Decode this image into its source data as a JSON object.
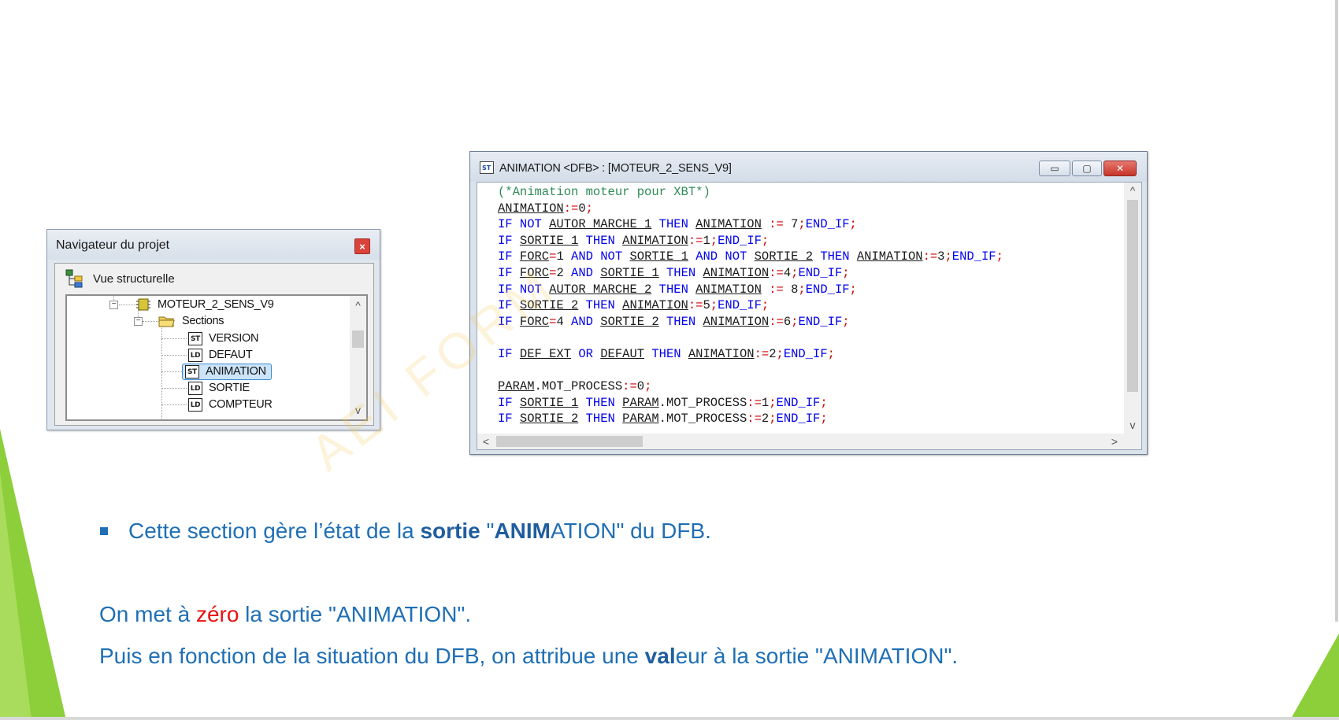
{
  "colors": {
    "slide_text": "#1f6fb5",
    "emphasis_red": "#e81010",
    "accent_green": "#8ccf3a",
    "code_keyword": "#0000ee",
    "code_operator": "#cc0000",
    "code_comment": "#2e8b57"
  },
  "navigator": {
    "title": "Navigateur du projet",
    "close_label": "×",
    "view_label": "Vue structurelle",
    "tree": {
      "root": "MOTEUR_2_SENS_V9",
      "sections_label": "Sections",
      "items": [
        {
          "type": "ST",
          "label": "VERSION"
        },
        {
          "type": "LD",
          "label": "DEFAUT"
        },
        {
          "type": "ST",
          "label": "ANIMATION",
          "selected": true
        },
        {
          "type": "LD",
          "label": "SORTIE"
        },
        {
          "type": "LD",
          "label": "COMPTEUR"
        }
      ]
    },
    "scroll_up": "^",
    "scroll_down": "v"
  },
  "code_window": {
    "title": "ANIMATION <DFB> : [MOTEUR_2_SENS_V9]",
    "icon": "st-section-icon",
    "min_label": "▭",
    "max_label": "▢",
    "close_label": "✕",
    "scroll_up": "^",
    "scroll_down": "v",
    "scroll_left": "<",
    "scroll_right": ">",
    "lines": [
      [
        {
          "t": "cmt",
          "s": "(*Animation moteur pour XBT*)"
        }
      ],
      [
        {
          "t": "var",
          "s": "ANIMATION"
        },
        {
          "t": "op",
          "s": ":="
        },
        {
          "t": "num",
          "s": "0"
        },
        {
          "t": "op",
          "s": ";"
        }
      ],
      [
        {
          "t": "kw",
          "s": "IF NOT "
        },
        {
          "t": "var",
          "s": "AUTOR MARCHE 1"
        },
        {
          "t": "kw",
          "s": " THEN "
        },
        {
          "t": "var",
          "s": "ANIMATION"
        },
        {
          "t": "op",
          "s": " := "
        },
        {
          "t": "num",
          "s": "7"
        },
        {
          "t": "op",
          "s": ";"
        },
        {
          "t": "kw",
          "s": "END_IF"
        },
        {
          "t": "op",
          "s": ";"
        }
      ],
      [
        {
          "t": "kw",
          "s": "IF "
        },
        {
          "t": "var",
          "s": "SORTIE 1"
        },
        {
          "t": "kw",
          "s": " THEN "
        },
        {
          "t": "var",
          "s": "ANIMATION"
        },
        {
          "t": "op",
          "s": ":="
        },
        {
          "t": "num",
          "s": "1"
        },
        {
          "t": "op",
          "s": ";"
        },
        {
          "t": "kw",
          "s": "END_IF"
        },
        {
          "t": "op",
          "s": ";"
        }
      ],
      [
        {
          "t": "kw",
          "s": "IF "
        },
        {
          "t": "var",
          "s": "FORC"
        },
        {
          "t": "op",
          "s": "="
        },
        {
          "t": "num",
          "s": "1"
        },
        {
          "t": "kw",
          "s": " AND NOT "
        },
        {
          "t": "var",
          "s": "SORTIE 1"
        },
        {
          "t": "kw",
          "s": " AND NOT "
        },
        {
          "t": "var",
          "s": "SORTIE 2"
        },
        {
          "t": "kw",
          "s": " THEN "
        },
        {
          "t": "var",
          "s": "ANIMATION"
        },
        {
          "t": "op",
          "s": ":="
        },
        {
          "t": "num",
          "s": "3"
        },
        {
          "t": "op",
          "s": ";"
        },
        {
          "t": "kw",
          "s": "END_IF"
        },
        {
          "t": "op",
          "s": ";"
        }
      ],
      [
        {
          "t": "kw",
          "s": "IF "
        },
        {
          "t": "var",
          "s": "FORC"
        },
        {
          "t": "op",
          "s": "="
        },
        {
          "t": "num",
          "s": "2"
        },
        {
          "t": "kw",
          "s": " AND "
        },
        {
          "t": "var",
          "s": "SORTIE 1"
        },
        {
          "t": "kw",
          "s": " THEN "
        },
        {
          "t": "var",
          "s": "ANIMATION"
        },
        {
          "t": "op",
          "s": ":="
        },
        {
          "t": "num",
          "s": "4"
        },
        {
          "t": "op",
          "s": ";"
        },
        {
          "t": "kw",
          "s": "END_IF"
        },
        {
          "t": "op",
          "s": ";"
        }
      ],
      [
        {
          "t": "kw",
          "s": "IF NOT "
        },
        {
          "t": "var",
          "s": "AUTOR MARCHE 2"
        },
        {
          "t": "kw",
          "s": " THEN "
        },
        {
          "t": "var",
          "s": "ANIMATION"
        },
        {
          "t": "op",
          "s": " := "
        },
        {
          "t": "num",
          "s": "8"
        },
        {
          "t": "op",
          "s": ";"
        },
        {
          "t": "kw",
          "s": "END_IF"
        },
        {
          "t": "op",
          "s": ";"
        }
      ],
      [
        {
          "t": "kw",
          "s": "IF "
        },
        {
          "t": "var",
          "s": "SORTIE 2"
        },
        {
          "t": "kw",
          "s": " THEN "
        },
        {
          "t": "var",
          "s": "ANIMATION"
        },
        {
          "t": "op",
          "s": ":="
        },
        {
          "t": "num",
          "s": "5"
        },
        {
          "t": "op",
          "s": ";"
        },
        {
          "t": "kw",
          "s": "END_IF"
        },
        {
          "t": "op",
          "s": ";"
        }
      ],
      [
        {
          "t": "kw",
          "s": "IF "
        },
        {
          "t": "var",
          "s": "FORC"
        },
        {
          "t": "op",
          "s": "="
        },
        {
          "t": "num",
          "s": "4"
        },
        {
          "t": "kw",
          "s": " AND "
        },
        {
          "t": "var",
          "s": "SORTIE 2"
        },
        {
          "t": "kw",
          "s": " THEN "
        },
        {
          "t": "var",
          "s": "ANIMATION"
        },
        {
          "t": "op",
          "s": ":="
        },
        {
          "t": "num",
          "s": "6"
        },
        {
          "t": "op",
          "s": ";"
        },
        {
          "t": "kw",
          "s": "END_IF"
        },
        {
          "t": "op",
          "s": ";"
        }
      ],
      [],
      [
        {
          "t": "kw",
          "s": "IF "
        },
        {
          "t": "var",
          "s": "DEF EXT"
        },
        {
          "t": "kw",
          "s": " OR "
        },
        {
          "t": "var",
          "s": "DEFAUT"
        },
        {
          "t": "kw",
          "s": " THEN "
        },
        {
          "t": "var",
          "s": "ANIMATION"
        },
        {
          "t": "op",
          "s": ":="
        },
        {
          "t": "num",
          "s": "2"
        },
        {
          "t": "op",
          "s": ";"
        },
        {
          "t": "kw",
          "s": "END_IF"
        },
        {
          "t": "op",
          "s": ";"
        }
      ],
      [],
      [
        {
          "t": "var",
          "s": "PARAM"
        },
        {
          "t": "pl",
          "s": ".MOT_PROCESS"
        },
        {
          "t": "op",
          "s": ":="
        },
        {
          "t": "num",
          "s": "0"
        },
        {
          "t": "op",
          "s": ";"
        }
      ],
      [
        {
          "t": "kw",
          "s": "IF "
        },
        {
          "t": "var",
          "s": "SORTIE 1"
        },
        {
          "t": "kw",
          "s": " THEN "
        },
        {
          "t": "var",
          "s": "PARAM"
        },
        {
          "t": "pl",
          "s": ".MOT_PROCESS"
        },
        {
          "t": "op",
          "s": ":="
        },
        {
          "t": "num",
          "s": "1"
        },
        {
          "t": "op",
          "s": ";"
        },
        {
          "t": "kw",
          "s": "END_IF"
        },
        {
          "t": "op",
          "s": ";"
        }
      ],
      [
        {
          "t": "kw",
          "s": "IF "
        },
        {
          "t": "var",
          "s": "SORTIE 2"
        },
        {
          "t": "kw",
          "s": " THEN "
        },
        {
          "t": "var",
          "s": "PARAM"
        },
        {
          "t": "pl",
          "s": ".MOT_PROCESS"
        },
        {
          "t": "op",
          "s": ":="
        },
        {
          "t": "num",
          "s": "2"
        },
        {
          "t": "op",
          "s": ";"
        },
        {
          "t": "kw",
          "s": "END_IF"
        },
        {
          "t": "op",
          "s": ";"
        }
      ]
    ]
  },
  "watermark": "AEI   FORM",
  "text": {
    "bullet": {
      "pre": "Cette section gère l’état de la ",
      "sortie": "sortie",
      "q1": " \"",
      "anim_bold": "ANIM",
      "anim_rest": "ATION\" du DFB."
    },
    "line1": {
      "pre": "On met à ",
      "zero": "zéro",
      "post": " la sortie \"ANIMATION\"."
    },
    "line2": {
      "pre": "Puis en fonction de la situation du DFB, on attribue une ",
      "val": "val",
      "post": "eur à la sortie \"ANIMATION\"."
    }
  }
}
